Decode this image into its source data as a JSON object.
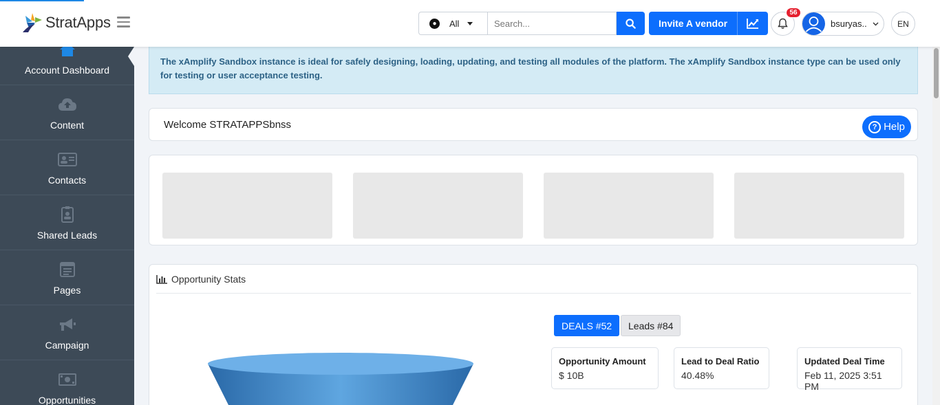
{
  "header": {
    "logo_text": "StratApps",
    "search_scope": "All",
    "search_placeholder": "Search...",
    "invite_label": "Invite A vendor",
    "notification_count": "56",
    "username": "bsuryas..",
    "language": "EN"
  },
  "sidebar": {
    "items": [
      {
        "label": "Account Dashboard",
        "icon": "home-icon"
      },
      {
        "label": "Content",
        "icon": "cloud-upload-icon"
      },
      {
        "label": "Contacts",
        "icon": "contact-card-icon"
      },
      {
        "label": "Shared Leads",
        "icon": "badge-icon"
      },
      {
        "label": "Pages",
        "icon": "page-icon"
      },
      {
        "label": "Campaign",
        "icon": "megaphone-icon"
      },
      {
        "label": "Opportunities",
        "icon": "money-icon"
      }
    ]
  },
  "alert": {
    "text": "The xAmplify Sandbox instance is ideal for safely designing, loading, updating, and testing all modules of the platform. The xAmplify Sandbox instance type can be used only for testing or user acceptance testing."
  },
  "welcome": {
    "title": "Welcome STRATAPPSbnss",
    "help_label": "Help"
  },
  "stats": {
    "title": "Opportunity Stats",
    "tab_deals": "DEALS #52",
    "tab_leads": "Leads #84",
    "boxes": [
      {
        "label": "Opportunity Amount",
        "value": "$ 10B"
      },
      {
        "label": "Lead to Deal Ratio",
        "value": "40.48%"
      },
      {
        "label": "Updated Deal Time",
        "value": "Feb 11, 2025 3:51 PM"
      }
    ]
  },
  "colors": {
    "primary": "#0d6efd",
    "sidebar": "#3d4a57",
    "alert_bg": "#d4ebf5",
    "badge": "#e5202f"
  }
}
